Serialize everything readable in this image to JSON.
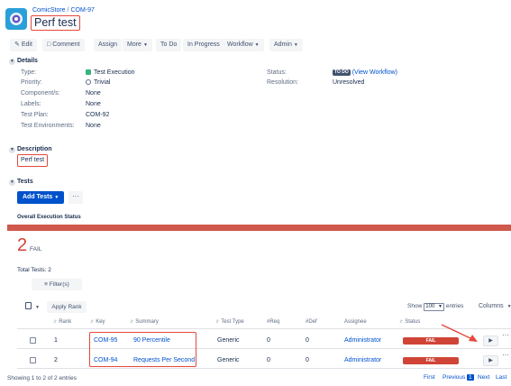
{
  "breadcrumb": {
    "project": "ComicStore",
    "separator": "/",
    "issue_key": "COM-97"
  },
  "issue_title": "Perf test",
  "toolbar": {
    "edit": "Edit",
    "comment": "Comment",
    "assign": "Assign",
    "more": "More",
    "todo": "To Do",
    "in_progress": "In Progress",
    "workflow": "Workflow",
    "admin": "Admin"
  },
  "details": {
    "heading": "Details",
    "type_label": "Type:",
    "type_value": "Test Execution",
    "priority_label": "Priority:",
    "priority_value": "Trivial",
    "components_label": "Component/s:",
    "components_value": "None",
    "labels_label": "Labels:",
    "labels_value": "None",
    "testplan_label": "Test Plan:",
    "testplan_value": "COM-92",
    "testenv_label": "Test Environments:",
    "testenv_value": "None",
    "status_label": "Status:",
    "status_value": "TO DO",
    "status_link": "(View Workflow)",
    "resolution_label": "Resolution:",
    "resolution_value": "Unresolved"
  },
  "description": {
    "heading": "Description",
    "text": "Perf test"
  },
  "tests": {
    "heading": "Tests",
    "add_tests": "Add Tests",
    "more": "···",
    "overall_label": "Overall Execution Status",
    "fail_count": "2",
    "fail_label": "FAIL",
    "fail_fraction": 1.0,
    "total_tests": "Total Tests: 2",
    "filter": "Filter(s)",
    "apply_rank": "Apply Rank",
    "show": "Show",
    "entries_value": "100",
    "entries": "entries",
    "columns": "Columns",
    "headers": {
      "rank": "Rank",
      "key": "Key",
      "summary": "Summary",
      "test_type": "Test Type",
      "req": "#Req",
      "def": "#Def",
      "assignee": "Assignee",
      "status": "Status"
    },
    "rows": [
      {
        "rank": "1",
        "key": "COM-95",
        "summary": "90 Percentile",
        "test_type": "Generic",
        "req": "0",
        "def": "0",
        "assignee": "Administrator",
        "status": "FAIL"
      },
      {
        "rank": "2",
        "key": "COM-94",
        "summary": "Requests Per Second",
        "test_type": "Generic",
        "req": "0",
        "def": "0",
        "assignee": "Administrator",
        "status": "FAIL"
      }
    ],
    "showing": "Showing 1 to 2 of 2 entries",
    "pagination": {
      "first": "First",
      "previous": "Previous",
      "current": "1",
      "next": "Next",
      "last": "Last"
    }
  },
  "colors": {
    "fail": "#d04437",
    "link": "#0052cc",
    "highlight": "#e5483b",
    "primary": "#0052cc"
  }
}
